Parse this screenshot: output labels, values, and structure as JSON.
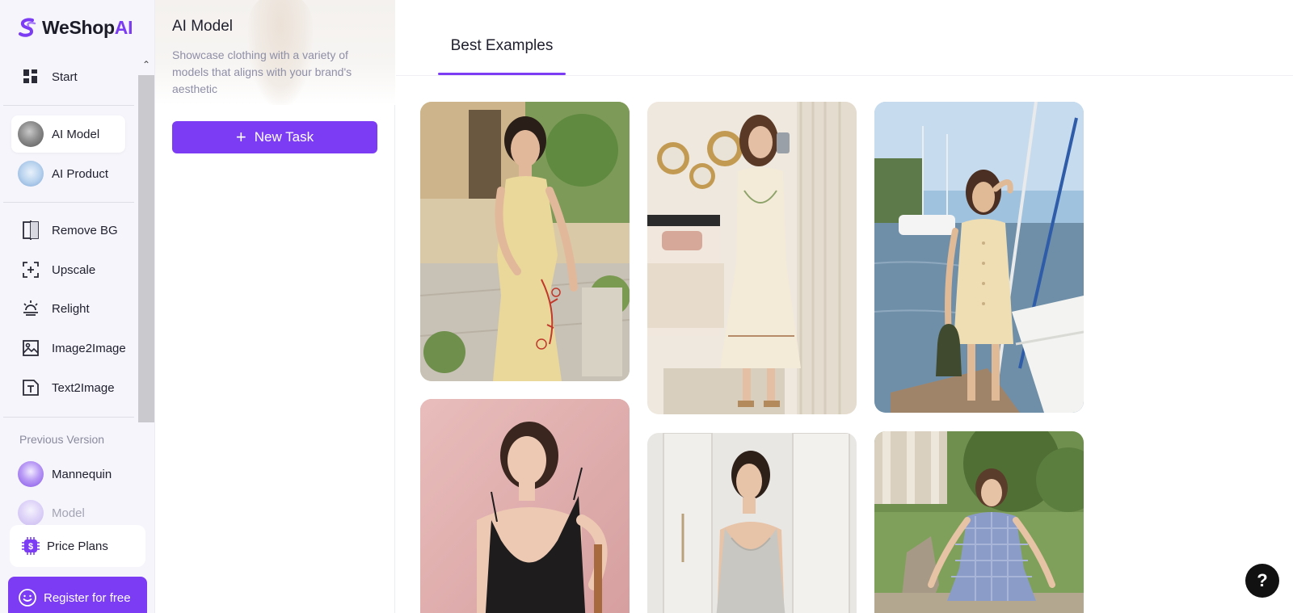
{
  "brand": {
    "name": "WeShop",
    "name_suffix": "AI"
  },
  "sidebar": {
    "start": "Start",
    "ai_model": "AI Model",
    "ai_product": "AI Product",
    "tools": {
      "remove_bg": "Remove BG",
      "upscale": "Upscale",
      "relight": "Relight",
      "image2image": "Image2Image",
      "text2image": "Text2Image"
    },
    "previous_version_label": "Previous Version",
    "mannequin": "Mannequin",
    "model": "Model",
    "price_plans": "Price Plans",
    "register": "Register for free"
  },
  "panel": {
    "title": "AI Model",
    "description": "Showcase clothing with a variety of models that aligns with your brand's aesthetic",
    "new_task": "New Task"
  },
  "main": {
    "tab": "Best Examples",
    "examples": [
      {
        "id": "ex1",
        "subject": "woman in yellow floral slip dress sitting on terrace"
      },
      {
        "id": "ex2",
        "subject": "woman in cream embroidered dress taking mirror selfie in bedroom"
      },
      {
        "id": "ex3",
        "subject": "woman in cream button dress at marina with handbag"
      },
      {
        "id": "ex4",
        "subject": "woman in black slip dress on pink background"
      },
      {
        "id": "ex5",
        "subject": "woman in grey cowl-neck top by white door"
      },
      {
        "id": "ex6",
        "subject": "woman in blue gingham dress sitting on stone wall in garden"
      }
    ]
  },
  "help": {
    "label": "?"
  },
  "colors": {
    "accent": "#7b3cf3",
    "sidebar_bg": "#f5f5fb"
  },
  "icons": {
    "start": "grid-icon",
    "remove_bg": "remove-bg-icon",
    "upscale": "upscale-icon",
    "relight": "relight-icon",
    "image2image": "image-icon",
    "text2image": "text-image-icon",
    "price_plans": "dollar-chip-icon",
    "register": "smile-icon"
  }
}
